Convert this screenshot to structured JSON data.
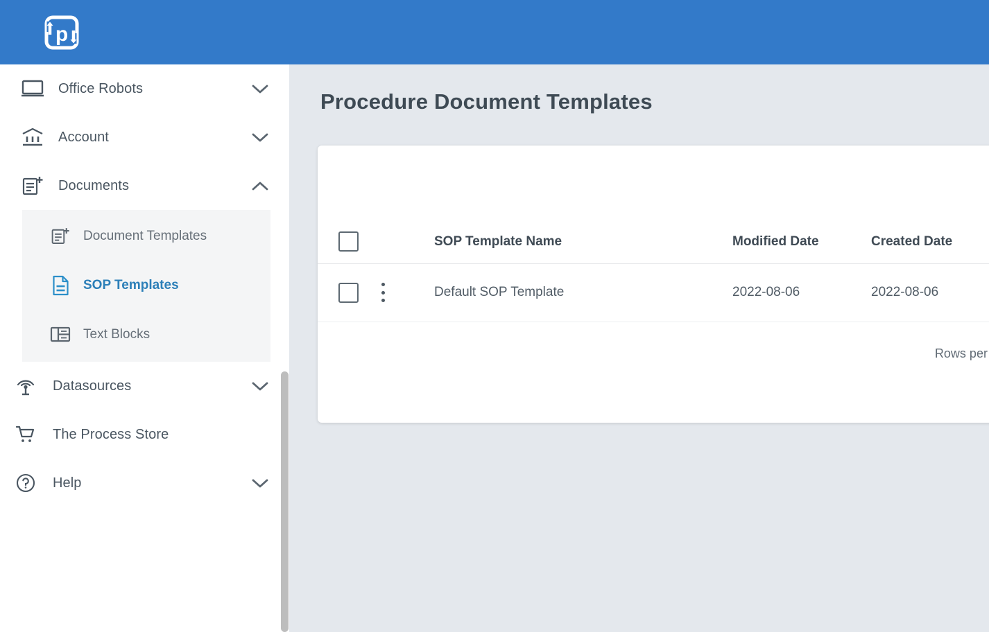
{
  "app": {
    "logo_icon": "process-p-logo-icon",
    "topbar_color": "#337ac9"
  },
  "sidebar": {
    "items": [
      {
        "label": "Office Robots",
        "icon": "monitor-icon",
        "chevron": "chevron-down-icon",
        "expanded": false
      },
      {
        "label": "Account",
        "icon": "bank-icon",
        "chevron": "chevron-down-icon",
        "expanded": false
      },
      {
        "label": "Documents",
        "icon": "document-add-icon",
        "chevron": "chevron-up-icon",
        "expanded": true
      },
      {
        "label": "Datasources",
        "icon": "antenna-icon",
        "chevron": "chevron-down-icon",
        "expanded": false
      },
      {
        "label": "The Process Store",
        "icon": "shopping-cart-icon",
        "chevron": "",
        "expanded": false
      },
      {
        "label": "Help",
        "icon": "question-circle-icon",
        "chevron": "chevron-down-icon",
        "expanded": false
      }
    ],
    "submenu": [
      {
        "label": "Document Templates",
        "icon": "document-add-icon",
        "active": false
      },
      {
        "label": "SOP Templates",
        "icon": "document-lines-icon",
        "active": true
      },
      {
        "label": "Text Blocks",
        "icon": "text-blocks-icon",
        "active": false
      }
    ],
    "active_color": "#2c7fb8"
  },
  "main": {
    "title": "Procedure Document Templates",
    "background": "#e4e8ed",
    "table": {
      "columns": [
        "SOP Template Name",
        "Modified Date",
        "Created Date"
      ],
      "select_all_checkbox": "select-all-checkbox",
      "rows": [
        {
          "name": "Default SOP Template",
          "modified_date": "2022-08-06",
          "created_date": "2022-08-06",
          "selected": false
        }
      ]
    },
    "footer": {
      "rows_per_page_label": "Rows per page:"
    }
  }
}
